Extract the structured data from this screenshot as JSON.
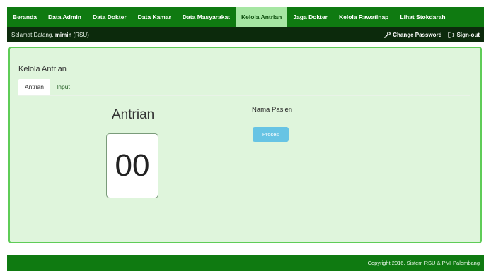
{
  "nav": {
    "items": [
      {
        "label": "Beranda"
      },
      {
        "label": "Data Admin"
      },
      {
        "label": "Data Dokter"
      },
      {
        "label": "Data Kamar"
      },
      {
        "label": "Data Masyarakat"
      },
      {
        "label": "Kelola Antrian",
        "active": true
      },
      {
        "label": "Jaga Dokter"
      },
      {
        "label": "Kelola Rawatinap"
      },
      {
        "label": "Lihat Stokdarah"
      }
    ]
  },
  "subbar": {
    "welcome_prefix": "Selamat Datang, ",
    "user": "mimin",
    "role": " (RSU)",
    "change_password": "Change Password",
    "sign_out": "Sign-out"
  },
  "panel": {
    "title": "Kelola Antrian",
    "tabs": [
      {
        "label": "Antrian"
      },
      {
        "label": "Input"
      }
    ],
    "antrian_label": "Antrian",
    "antrian_number": "00",
    "nama_pasien_label": "Nama Pasien",
    "proses_button": "Proses"
  },
  "footer": {
    "text": "Copyright 2016, Sistem RSU & PMI Palembang"
  }
}
